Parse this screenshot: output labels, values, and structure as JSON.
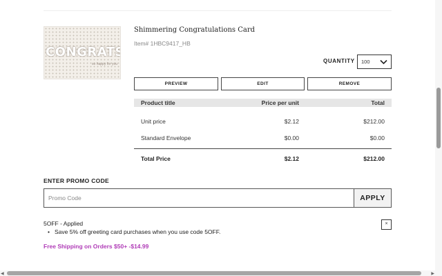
{
  "product": {
    "image_text": "CONGRATS",
    "image_tagline": "so happy for you",
    "title": "Shimmering Congratulations Card",
    "item_number": "Item# 1HBC9417_HB",
    "quantity_label": "QUANTITY",
    "quantity_value": "100"
  },
  "actions": {
    "preview": "PREVIEW",
    "edit": "EDIT",
    "remove": "REMOVE"
  },
  "price_table": {
    "headers": [
      "Product title",
      "Price per unit",
      "Total"
    ],
    "rows": [
      {
        "label": "Unit price",
        "price": "$2.12",
        "total": "$212.00"
      },
      {
        "label": "Standard Envelope",
        "price": "$0.00",
        "total": "$0.00"
      }
    ],
    "total": {
      "label": "Total Price",
      "price": "$2.12",
      "total": "$212.00"
    }
  },
  "promo": {
    "heading": "ENTER PROMO CODE",
    "placeholder": "Promo Code",
    "apply_label": "APPLY",
    "applied_title": "5OFF - Applied",
    "applied_description": "Save 5% off greeting card purchases when you use code 5OFF.",
    "remove_symbol": "×"
  },
  "shipping": {
    "text": "Free Shipping on Orders $50+ -$14.99",
    "color": "#b03cb7"
  },
  "icons": {
    "dropdown": "chevron-down-icon",
    "close": "close-icon"
  }
}
